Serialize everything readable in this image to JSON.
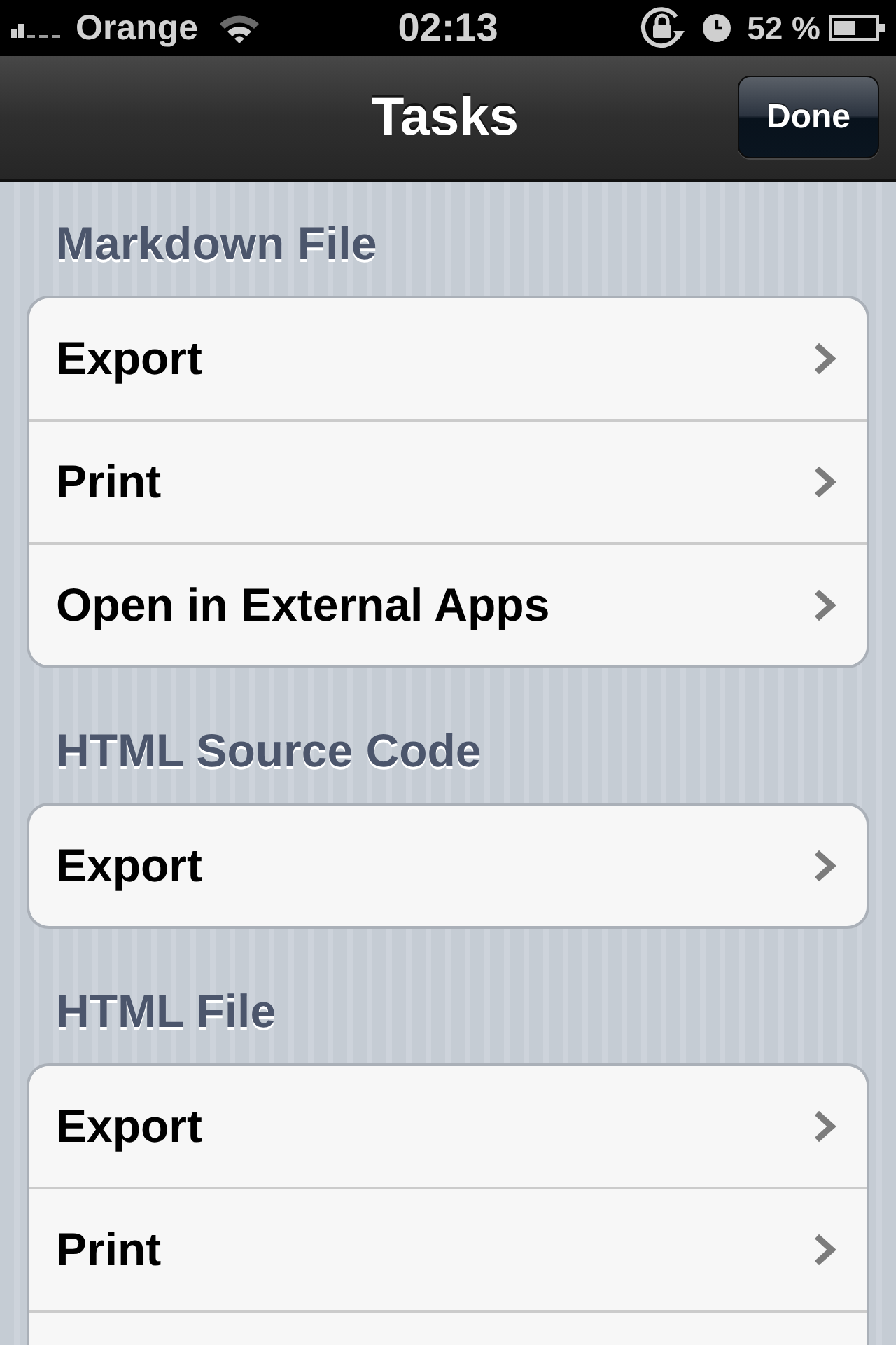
{
  "status_bar": {
    "carrier": "Orange",
    "time": "02:13",
    "battery": "52 %"
  },
  "nav_bar": {
    "title": "Tasks",
    "done_button": "Done"
  },
  "sections": [
    {
      "title": "Markdown File",
      "continues": false,
      "rows": [
        {
          "label": "Export",
          "chevron": true
        },
        {
          "label": "Print",
          "chevron": true
        },
        {
          "label": "Open in External Apps",
          "chevron": true
        }
      ]
    },
    {
      "title": "HTML Source Code",
      "continues": false,
      "rows": [
        {
          "label": "Export",
          "chevron": true
        }
      ]
    },
    {
      "title": "HTML File",
      "continues": true,
      "rows": [
        {
          "label": "Export",
          "chevron": true
        },
        {
          "label": "Print",
          "chevron": true
        }
      ]
    }
  ]
}
